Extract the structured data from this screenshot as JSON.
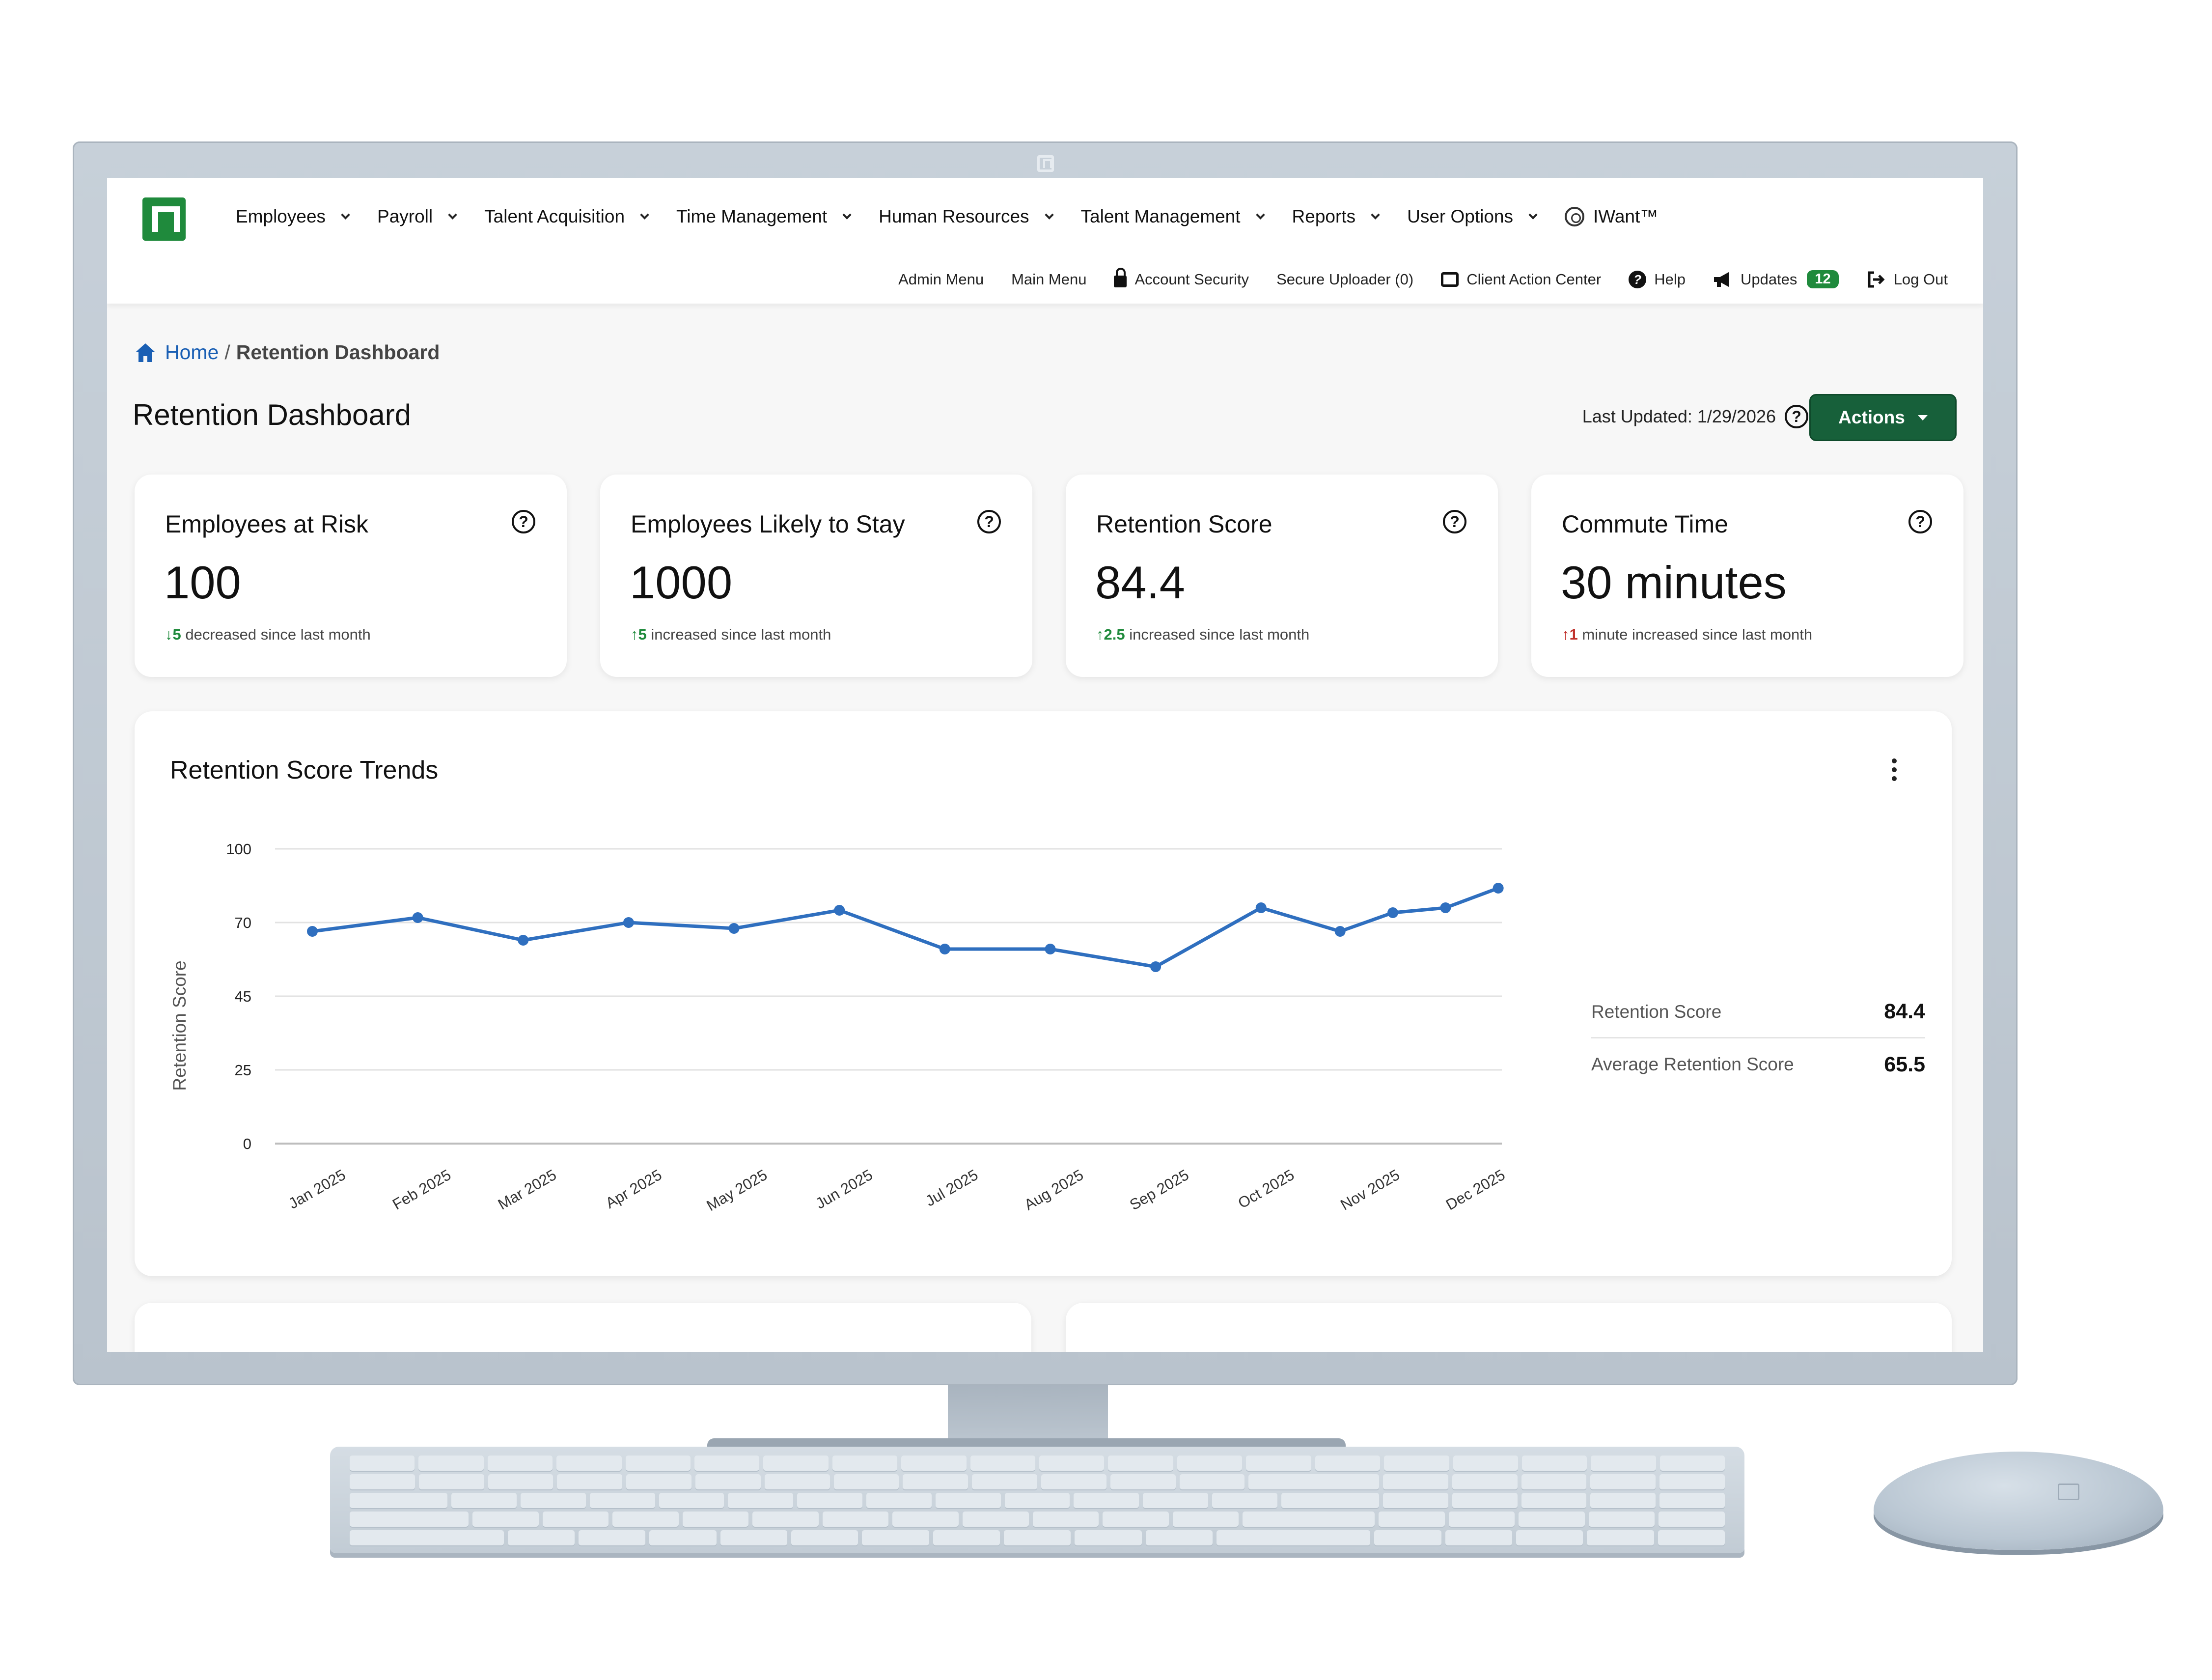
{
  "nav": {
    "menu": [
      {
        "label": "Employees"
      },
      {
        "label": "Payroll"
      },
      {
        "label": "Talent Acquisition"
      },
      {
        "label": "Time Management"
      },
      {
        "label": "Human Resources"
      },
      {
        "label": "Talent Management"
      },
      {
        "label": "Reports"
      },
      {
        "label": "User Options"
      }
    ],
    "iwant_label": "IWant™",
    "utility": {
      "admin_menu": "Admin Menu",
      "main_menu": "Main Menu",
      "account_security": "Account Security",
      "secure_uploader": "Secure Uploader (0)",
      "client_action_center": "Client Action Center",
      "help": "Help",
      "updates": "Updates",
      "updates_count": "12",
      "log_out": "Log Out"
    }
  },
  "breadcrumb": {
    "home": "Home",
    "separator": "/",
    "current": "Retention Dashboard"
  },
  "page": {
    "title": "Retention Dashboard",
    "last_updated_label": "Last Updated: 1/29/2026",
    "actions_label": "Actions"
  },
  "kpis": [
    {
      "title": "Employees at Risk",
      "value": "100",
      "arrow": "↓",
      "delta_value": "5",
      "delta_text": "decreased since last month"
    },
    {
      "title": "Employees Likely to Stay",
      "value": "1000",
      "arrow": "↑",
      "delta_value": "5",
      "delta_text": "increased since last month"
    },
    {
      "title": "Retention Score",
      "value": "84.4",
      "arrow": "↑",
      "delta_value": "2.5",
      "delta_text": "increased since last month"
    },
    {
      "title": "Commute Time",
      "value": "30 minutes",
      "arrow": "↑",
      "delta_value": "1",
      "delta_text": "minute increased since last month"
    }
  ],
  "trend": {
    "title": "Retention Score Trends",
    "legend": [
      {
        "label": "Retention Score",
        "value": "84.4"
      },
      {
        "label": "Average Retention Score",
        "value": "65.5"
      }
    ]
  },
  "colors": {
    "brand_green": "#1f8a3c",
    "actions_green": "#17603a",
    "line_blue": "#2f6fbf",
    "link_blue": "#1a5fb4",
    "delta_red": "#c0312c"
  },
  "icons": {
    "logo": "brand-logo-icon",
    "home": "home-icon",
    "help": "question-circle-icon",
    "lock": "lock-icon",
    "updates": "megaphone-icon",
    "logout": "logout-icon",
    "kebab": "kebab-menu-icon"
  },
  "chart_data": {
    "type": "line",
    "title": "Retention Score Trends",
    "xlabel": "",
    "ylabel": "Retention Score",
    "categories": [
      "Jan 2025",
      "Feb 2025",
      "Mar 2025",
      "Apr 2025",
      "May 2025",
      "Jun 2025",
      "Jul 2025",
      "Aug 2025",
      "Sep 2025",
      "Oct 2025",
      "Nov 2025",
      "Dec 2025"
    ],
    "y_ticks": [
      0,
      25,
      45,
      70,
      100
    ],
    "ylim": [
      0,
      100
    ],
    "grid": true,
    "series": [
      {
        "name": "Retention Score",
        "values": [
          67,
          72,
          64,
          70,
          68,
          75,
          61,
          61,
          55,
          76,
          67,
          74,
          76,
          84
        ]
      }
    ],
    "series_x": [
      "Jan 2025",
      "Feb 2025",
      "Mar 2025",
      "Apr 2025",
      "May 2025",
      "Jun 2025",
      "Jul 2025",
      "Aug 2025",
      "Sep 2025",
      "Oct 2025",
      "Nov 2025",
      "Nov 2025",
      "Dec 2025",
      "Dec 2025"
    ]
  }
}
